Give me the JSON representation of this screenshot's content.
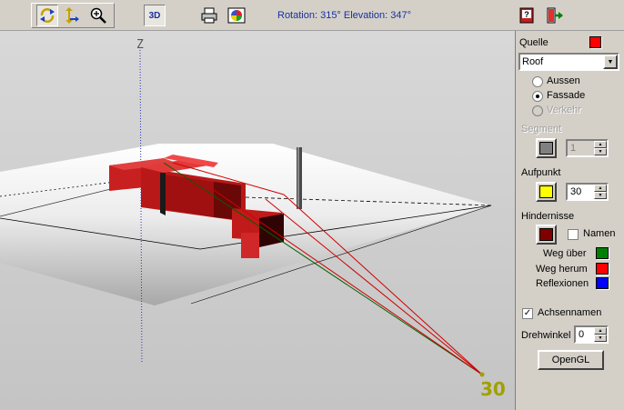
{
  "toolbar": {
    "status": "Rotation: 315° Elevation: 347°",
    "buttons": [
      {
        "icon": "rotate-icon",
        "pressed": true
      },
      {
        "icon": "move-icon",
        "pressed": false
      },
      {
        "icon": "zoom-icon",
        "pressed": false
      },
      {
        "icon": "3d-toggle",
        "label": "3D",
        "pressed": true
      },
      {
        "icon": "printer-icon"
      },
      {
        "icon": "color-palette-icon"
      },
      {
        "icon": "help-icon"
      },
      {
        "icon": "exit-icon"
      }
    ]
  },
  "viewport": {
    "axis_label": "Z",
    "point_label": "30"
  },
  "panel": {
    "quelle_label": "Quelle",
    "quelle_color": "#ff0000",
    "source_select": "Roof",
    "radios": [
      {
        "label": "Aussen",
        "checked": false,
        "disabled": false
      },
      {
        "label": "Fassade",
        "checked": true,
        "disabled": false
      },
      {
        "label": "Verkehr",
        "checked": false,
        "disabled": true
      }
    ],
    "segment_label": "Segment",
    "segment_value": "1",
    "segment_color": "#808080",
    "aufpunkt_label": "Aufpunkt",
    "aufpunkt_value": "30",
    "aufpunkt_color": "#ffff00",
    "hindernisse_label": "Hindernisse",
    "hindernisse_color": "#800000",
    "namen_label": "Namen",
    "namen_checked": false,
    "legend": [
      {
        "label": "Weg über",
        "color": "#008000"
      },
      {
        "label": "Weg herum",
        "color": "#ff0000"
      },
      {
        "label": "Reflexionen",
        "color": "#0000ff"
      }
    ],
    "achsennamen_label": "Achsennamen",
    "achsennamen_checked": true,
    "drehwinkel_label": "Drehwinkel",
    "drehwinkel_value": "0",
    "opengl_label": "OpenGL"
  }
}
